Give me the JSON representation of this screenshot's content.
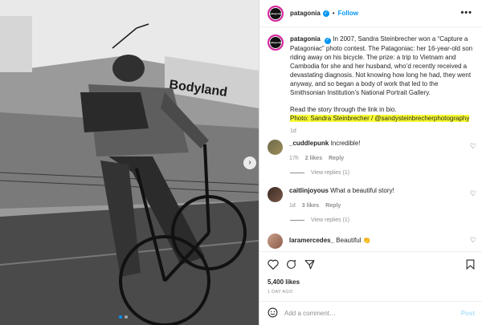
{
  "post": {
    "avatar_text": "patagonia",
    "username": "patagonia",
    "separator": "•",
    "follow_label": "Follow",
    "more_label": "•••"
  },
  "caption": {
    "username": "patagonia",
    "text": "In 2007, Sandra Steinbrecher won a “Capture a Patagoniac” photo contest. The Patagoniac: her 16-year-old son riding away on his bicycle. The prize: a trip to Vietnam and Cambodia for she and her husband, who’d recently received a devastating diagnosis. Not knowing how long he had, they went anyway, and so began a body of work that led to the Smithsonian Institution’s National Portrait Gallery.",
    "read_more": "Read the story through the link in bio.",
    "photo_credit": "Photo: Sandra Steinbrecher / @sandysteinbrecherphotography",
    "age": "1d"
  },
  "comments": [
    {
      "username": "_cuddlepunk",
      "text": "Incredible!",
      "age": "17h",
      "likes": "2 likes",
      "reply": "Reply",
      "view_replies": "View replies (1)"
    },
    {
      "username": "caitlinjoyous",
      "text": "What a beautiful story!",
      "age": "1d",
      "likes": "3 likes",
      "reply": "Reply",
      "view_replies": "View replies (1)"
    },
    {
      "username": "laramercedes_",
      "text": "Beautiful",
      "emoji": "👏"
    }
  ],
  "stats": {
    "likes": "5,400 likes",
    "date": "1 DAY AGO"
  },
  "add_comment": {
    "placeholder": "Add a comment…",
    "post_label": "Post"
  },
  "photo": {
    "billboard_text": "Bodyland",
    "carousel_next": "›"
  },
  "icons": {
    "heart": "heart-icon",
    "comment": "comment-icon",
    "share": "share-icon",
    "bookmark": "bookmark-icon",
    "emoji": "smiley-icon"
  },
  "colors": {
    "accent": "#0095f6",
    "highlight": "#f8ff33",
    "muted": "#8e8e8e"
  }
}
